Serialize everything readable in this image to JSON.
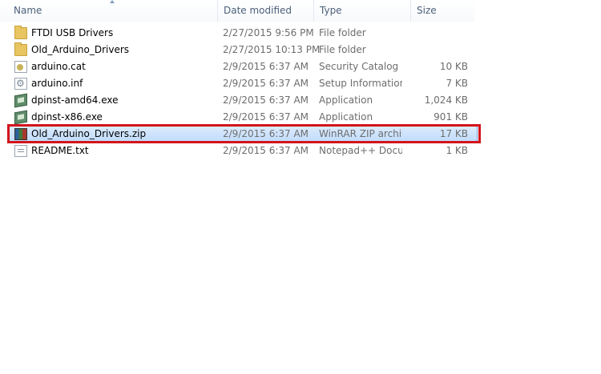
{
  "columns": {
    "name": "Name",
    "date": "Date modified",
    "type": "Type",
    "size": "Size"
  },
  "files": [
    {
      "name": "FTDI USB Drivers",
      "date": "2/27/2015 9:56 PM",
      "type": "File folder",
      "size": "",
      "icon": "folder-icon"
    },
    {
      "name": "Old_Arduino_Drivers",
      "date": "2/27/2015 10:13 PM",
      "type": "File folder",
      "size": "",
      "icon": "folder-icon"
    },
    {
      "name": "arduino.cat",
      "date": "2/9/2015 6:37 AM",
      "type": "Security Catalog",
      "size": "10 KB",
      "icon": "security-catalog-icon"
    },
    {
      "name": "arduino.inf",
      "date": "2/9/2015 6:37 AM",
      "type": "Setup Information",
      "size": "7 KB",
      "icon": "setup-info-icon"
    },
    {
      "name": "dpinst-amd64.exe",
      "date": "2/9/2015 6:37 AM",
      "type": "Application",
      "size": "1,024 KB",
      "icon": "application-icon"
    },
    {
      "name": "dpinst-x86.exe",
      "date": "2/9/2015 6:37 AM",
      "type": "Application",
      "size": "901 KB",
      "icon": "application-icon"
    },
    {
      "name": "Old_Arduino_Drivers.zip",
      "date": "2/9/2015 6:37 AM",
      "type": "WinRAR ZIP archive",
      "size": "17 KB",
      "icon": "winrar-zip-icon",
      "selected": true
    },
    {
      "name": "README.txt",
      "date": "2/9/2015 6:37 AM",
      "type": "Notepad++ Docu...",
      "size": "1 KB",
      "icon": "text-file-icon"
    }
  ],
  "colors": {
    "header_text": "#4c607a",
    "selection": "#c1dcfc",
    "highlight_border": "#d3141b"
  }
}
